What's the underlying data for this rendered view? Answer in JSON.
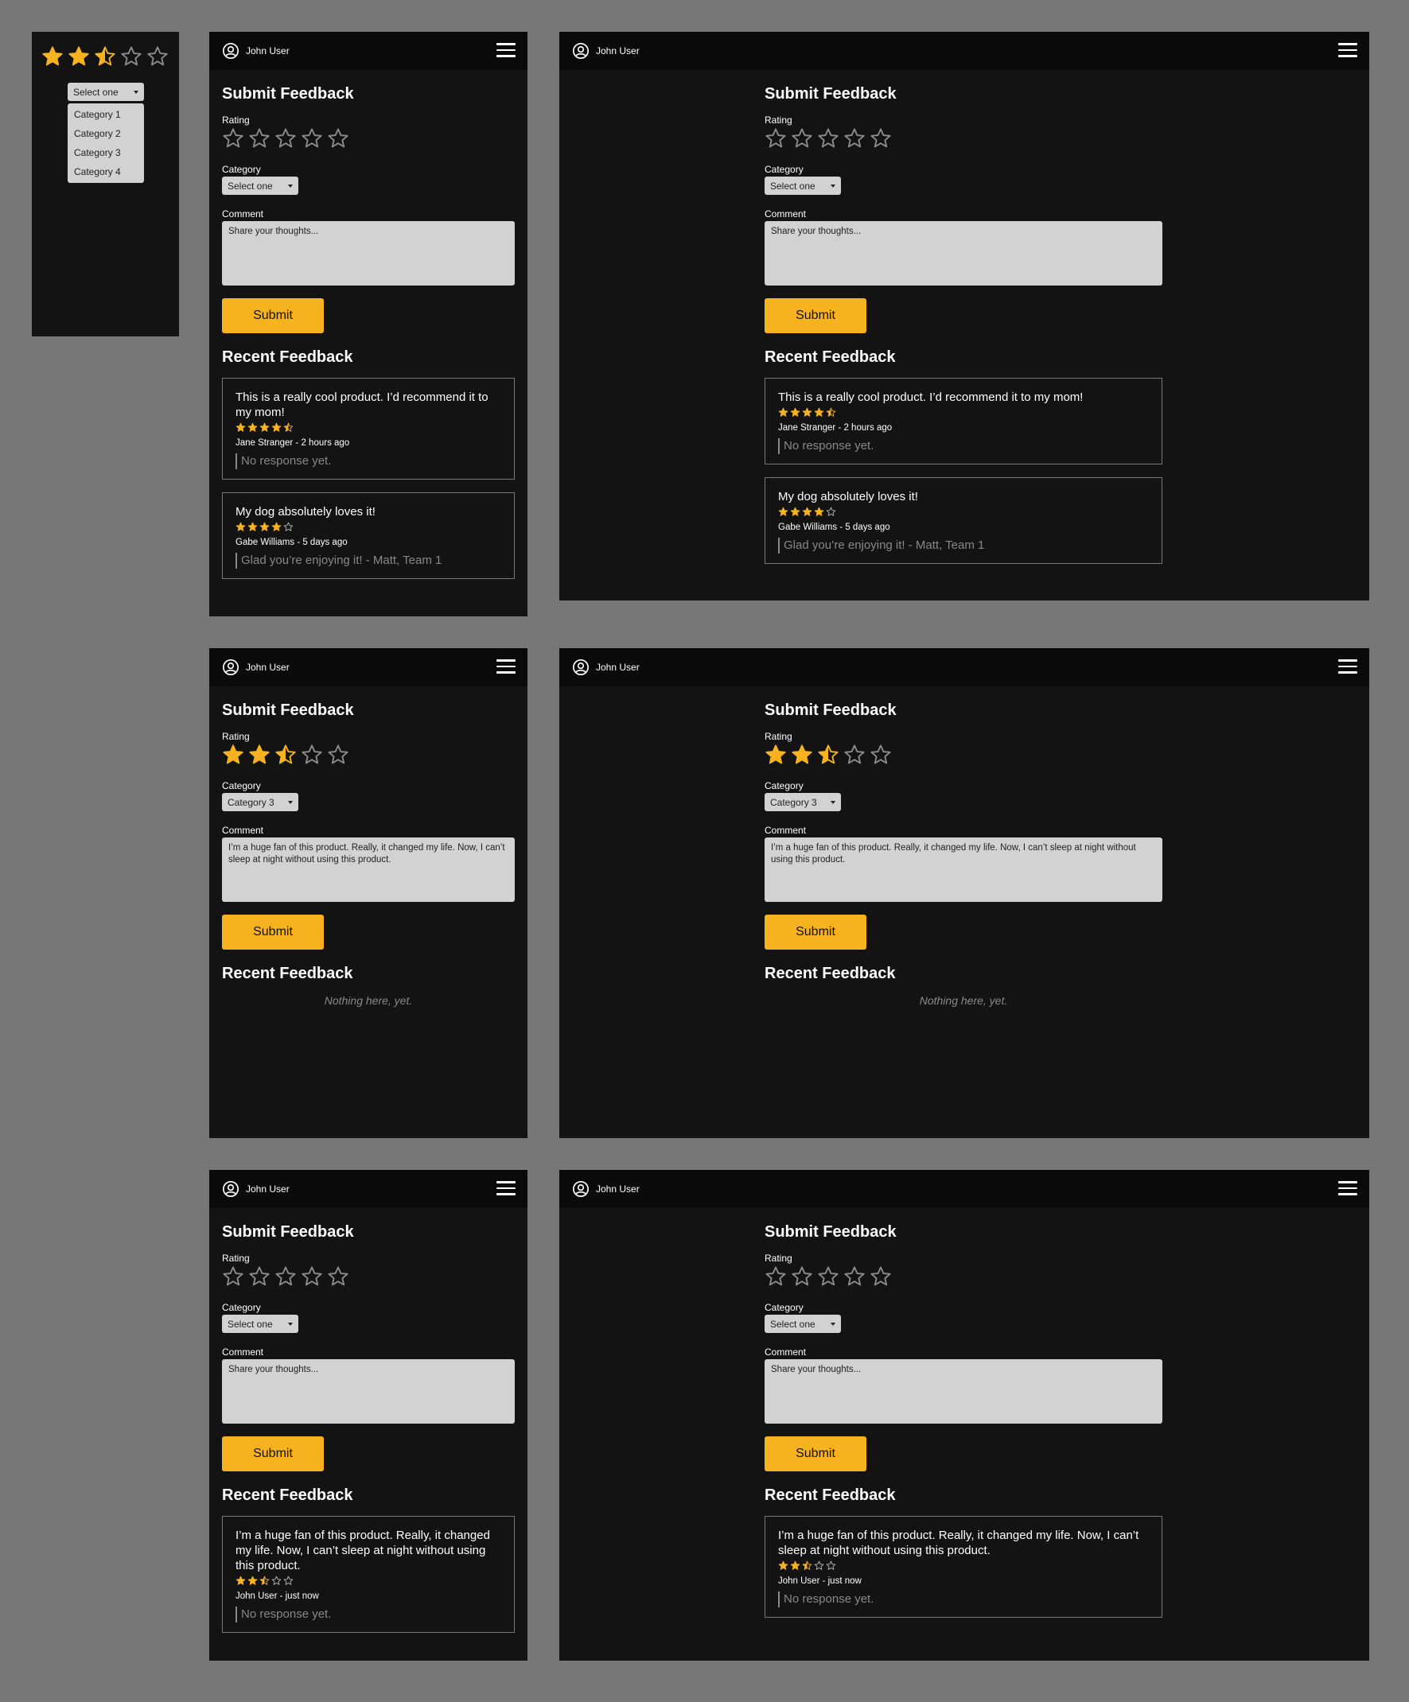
{
  "user_name": "John User",
  "colors": {
    "accent": "#f7b21f",
    "background": "#131313",
    "topbar": "#0a0a0a",
    "canvas": "#777777",
    "input": "#d2d2d2"
  },
  "icons": {
    "user": "user-circle-icon",
    "menu": "hamburger-menu-icon",
    "star": "star-icon"
  },
  "form": {
    "title": "Submit Feedback",
    "rating_label": "Rating",
    "category_label": "Category",
    "comment_label": "Comment",
    "placeholder": "Share your thoughts...",
    "select_default": "Select one",
    "submit_label": "Submit"
  },
  "recent_title": "Recent Feedback",
  "empty_text": "Nothing here, yet.",
  "dropdown_demo": {
    "rating": 2.5,
    "selected": "Select one",
    "options": [
      "Category 1",
      "Category 2",
      "Category 3",
      "Category 4"
    ]
  },
  "states": {
    "default": {
      "rating": 0,
      "category": "Select one",
      "comment": "Share your thoughts...",
      "feedback": [
        {
          "text": "This is a really cool product. I’d recommend it to my mom!",
          "rating": 4.5,
          "author": "Jane Stranger - 2 hours ago",
          "response": "No response yet."
        },
        {
          "text": "My dog absolutely loves it!",
          "rating": 4,
          "author": "Gabe Williams - 5 days ago",
          "response": "Glad you’re enjoying it! - Matt, Team 1"
        }
      ]
    },
    "filled": {
      "rating": 2.5,
      "category": "Category 3",
      "comment": "I’m a huge fan of this product. Really, it changed my life. Now, I can’t sleep at night without using this product.",
      "feedback": []
    },
    "submitted": {
      "rating": 0,
      "category": "Select one",
      "comment": "Share your thoughts...",
      "feedback": [
        {
          "text": "I’m a huge fan of this product. Really, it changed my life. Now, I can’t sleep at night without using this product.",
          "rating": 2.5,
          "author": "John User - just now",
          "response": "No response yet."
        }
      ]
    }
  }
}
